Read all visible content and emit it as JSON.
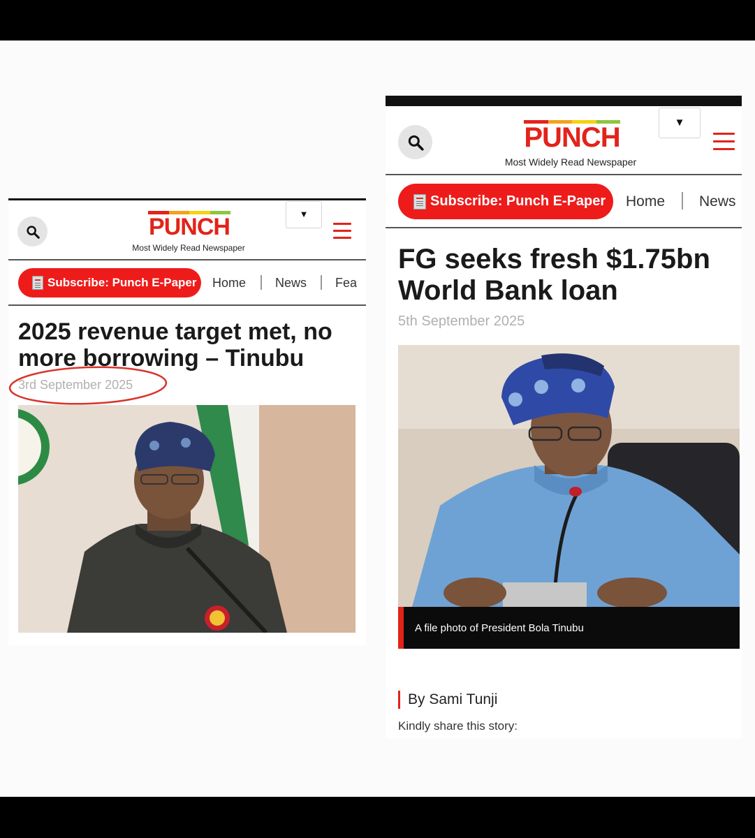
{
  "left": {
    "logo": "PUNCH",
    "tagline": "Most Widely Read Newspaper",
    "subscribe": "Subscribe: Punch E-Paper",
    "nav": [
      "Home",
      "News",
      "Fea"
    ],
    "headline": "2025 revenue target met, no more borrowing – Tinubu",
    "date": "3rd September 2025"
  },
  "right": {
    "logo": "PUNCH",
    "tagline": "Most Widely Read Newspaper",
    "subscribe": "Subscribe: Punch E-Paper",
    "nav": [
      "Home",
      "News"
    ],
    "headline": "FG seeks fresh $1.75bn World Bank loan",
    "date": "5th September 2025",
    "caption": "A file photo of President Bola Tinubu",
    "byline": "By Sami Tunji",
    "share": "Kindly share this story:"
  },
  "icons": {
    "search": "search-icon",
    "dropdown": "chevron-down-icon",
    "menu": "hamburger-menu-icon",
    "epaper": "newspaper-icon"
  },
  "colors": {
    "brand_red": "#e2231a",
    "subscribe_bg": "#ee1b1b",
    "annotation_circle": "#d9342b",
    "logo_stripe": [
      "#e2231a",
      "#f3a21b",
      "#f5d20f",
      "#8dc63f"
    ]
  }
}
